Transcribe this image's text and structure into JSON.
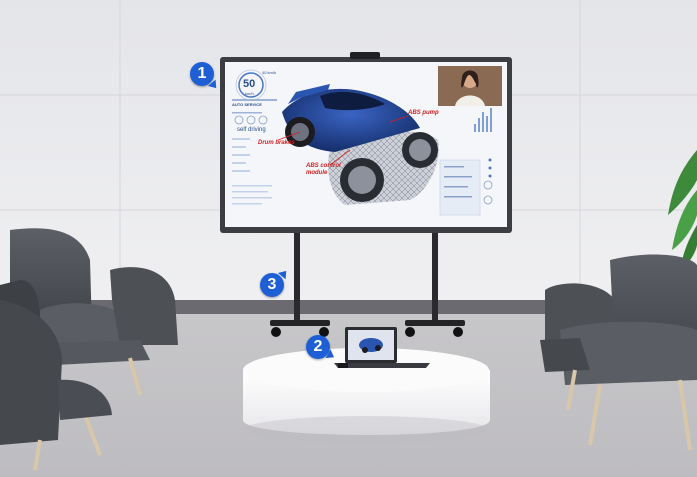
{
  "callouts": [
    "1",
    "2",
    "3"
  ],
  "screen": {
    "speed_value": "50",
    "speed_unit": "km/h",
    "top_label": "40 km/h",
    "auto_service_label": "AUTO SERVICE",
    "self_driving_label": "self driving",
    "annotations": {
      "drum_brakes": "Drum brakes",
      "abs_pump": "ABS pump",
      "abs_module": "ABS control module"
    }
  },
  "colors": {
    "badge": "#1f5fd6",
    "annotation": "#d31f1f",
    "car_body": "#1d3f8a"
  }
}
